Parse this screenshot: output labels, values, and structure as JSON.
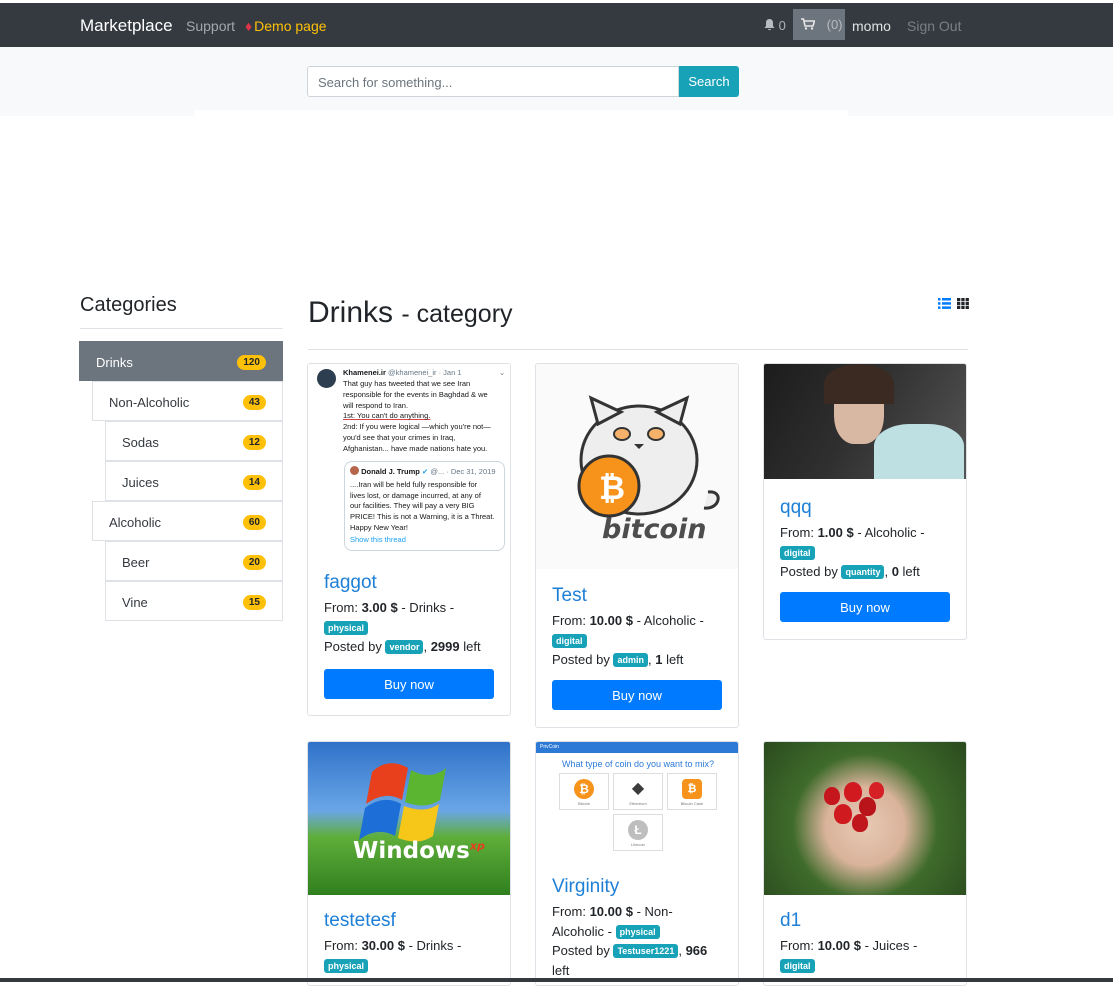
{
  "navbar": {
    "brand": "Marketplace",
    "support": "Support",
    "demo": "Demo page",
    "notifications": "0",
    "cart_count": "(0)",
    "username": "momo",
    "signout": "Sign Out"
  },
  "search": {
    "placeholder": "Search for something...",
    "button": "Search"
  },
  "sidebar": {
    "title": "Categories",
    "items": [
      {
        "label": "Drinks",
        "count": "120"
      },
      {
        "label": "Non-Alcoholic",
        "count": "43"
      },
      {
        "label": "Sodas",
        "count": "12"
      },
      {
        "label": "Juices",
        "count": "14"
      },
      {
        "label": "Alcoholic",
        "count": "60"
      },
      {
        "label": "Beer",
        "count": "20"
      },
      {
        "label": "Vine",
        "count": "15"
      }
    ]
  },
  "main": {
    "title": "Drinks",
    "subtitle": "- category"
  },
  "products": [
    {
      "title": "faggot",
      "from": "From:",
      "price": "3.00 $",
      "category": "- Drinks -",
      "type": "physical",
      "posted_by": "Posted by",
      "seller": "vendor",
      "stock": "2999",
      "left": "left",
      "buy": "Buy now",
      "image_text": {
        "user": "Khamenei.ir",
        "handle": "@khamenei_ir · Jan 1",
        "line1": "That guy has tweeted that we see Iran",
        "line2": "responsible for the events in Baghdad & we",
        "line3": "will respond to Iran.",
        "line4": "1st: You can't do anything.",
        "line5": "2nd: If you were logical —which you're not—",
        "line6": "you'd see that your crimes in Iraq,",
        "line7": "Afghanistan... have made nations hate you.",
        "q_user": "Donald J. Trump",
        "q_handle": "@... · Dec 31, 2019",
        "q1": "....Iran will be held fully responsible for",
        "q2": "lives lost, or damage incurred, at any of",
        "q3": "our facilities. They will pay a very BIG",
        "q4": "PRICE! This is not a Warning, it is a Threat.",
        "q5": "Happy New Year!",
        "thread": "Show this thread"
      }
    },
    {
      "title": "Test",
      "from": "From:",
      "price": "10.00 $",
      "category": "- Alcoholic -",
      "type": "digital",
      "posted_by": "Posted by",
      "seller": "admin",
      "stock": "1",
      "left": "left",
      "buy": "Buy now",
      "image_text": {
        "logo": "bitcoin"
      }
    },
    {
      "title": "qqq",
      "from": "From:",
      "price": "1.00 $",
      "category": "- Alcoholic -",
      "type": "digital",
      "posted_by": "Posted by",
      "seller": "quantity",
      "stock": "0",
      "left": "left",
      "buy": "Buy now"
    },
    {
      "title": "testetesf",
      "from": "From:",
      "price": "30.00 $",
      "category": "- Drinks -",
      "type": "physical",
      "image_text": {
        "logo": "Windows",
        "sup": "xp"
      }
    },
    {
      "title": "Virginity",
      "from": "From:",
      "price": "10.00 $",
      "category": "- Non-",
      "category2": "Alcoholic -",
      "type": "physical",
      "posted_by": "Posted by",
      "seller": "Testuser1221",
      "stock": "966",
      "left": "left",
      "image_text": {
        "question": "What type of coin do you want to mix?",
        "c1": "Bitcoin",
        "c2": "Ethereum",
        "c3": "Bitcoin Cash",
        "c4": "Litecoin",
        "brand": "PrivCoin"
      }
    },
    {
      "title": "d1",
      "from": "From:",
      "price": "10.00 $",
      "category": "- Juices -",
      "type": "digital"
    }
  ],
  "colors": {
    "navbar": "#343a40",
    "accent": "#17a2b8",
    "primary": "#007bff",
    "badge": "#ffc107",
    "link": "#1e7fd6"
  }
}
